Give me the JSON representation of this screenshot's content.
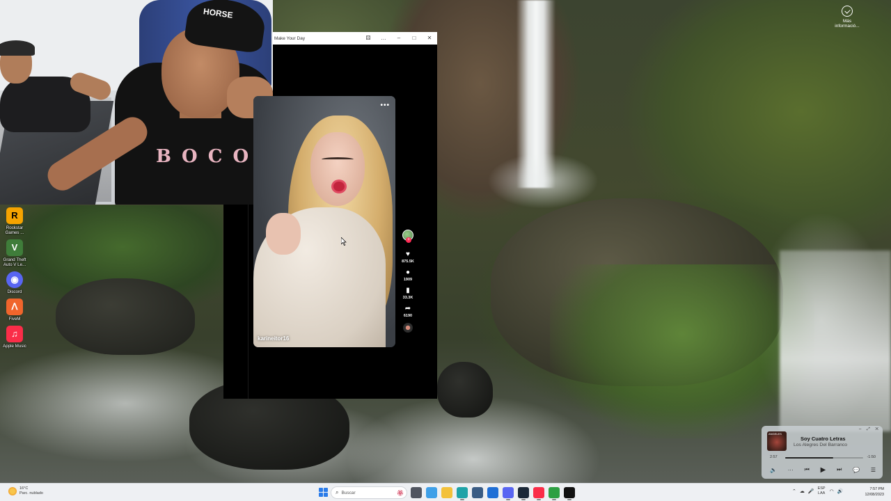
{
  "desktop": {
    "info_widget_label": "Más informació...",
    "icons": [
      {
        "label": "Rockstar Games ...",
        "glyph": "R",
        "color": "#f5a300"
      },
      {
        "label": "Grand Theft Auto V Le...",
        "glyph": "V",
        "color": "#3f7d3a"
      },
      {
        "label": "Discord",
        "glyph": "◉",
        "color": "#5865f2"
      },
      {
        "label": "FiveM",
        "glyph": "ᐱ",
        "color": "#f0652c"
      },
      {
        "label": "Apple Music",
        "glyph": "♫",
        "color": "#fa2d48"
      }
    ]
  },
  "webcam": {
    "cap_logo": "HORSE",
    "shirt_text": "B O C O"
  },
  "window": {
    "title": "Make Your Day",
    "buttons": {
      "game": "⚄",
      "more": "…",
      "minimize": "–",
      "maximize": "□",
      "close": "✕"
    }
  },
  "video": {
    "more_label": "•••",
    "username": "karineitor16",
    "actions": [
      {
        "name": "like",
        "icon": "♥",
        "count": "875.5K"
      },
      {
        "name": "comment",
        "icon": "●",
        "count": "1909"
      },
      {
        "name": "bookmark",
        "icon": "▮",
        "count": "33.3K"
      },
      {
        "name": "share",
        "icon": "➦",
        "count": "6190"
      }
    ]
  },
  "mini_player": {
    "controls_top": "–  ⤢  ✕",
    "art_text": "ANGELES",
    "title": "Soy Cuatro Letras",
    "artist": "Los Alegres Del Barranco",
    "elapsed": "2:57",
    "remaining": "-1:50",
    "progress": 0.62,
    "buttons": {
      "volume": "🔈",
      "options": "···",
      "previous": "⏮",
      "play": "▶",
      "next": "⏭",
      "lyrics": "💬",
      "queue": "☰"
    }
  },
  "taskbar": {
    "weather_temp": "16°C",
    "weather_desc": "Parc. nublado",
    "search_placeholder": "Buscar",
    "search_deco": "🏵",
    "apps": [
      {
        "name": "task-view",
        "color": "#505560",
        "active": false
      },
      {
        "name": "copilot",
        "color": "#3fa0e8",
        "active": false
      },
      {
        "name": "file-explorer",
        "color": "#f3c13a",
        "active": false
      },
      {
        "name": "edge",
        "color": "#1fa3a8",
        "active": true
      },
      {
        "name": "calculator",
        "color": "#3a5c84",
        "active": false
      },
      {
        "name": "outlook",
        "color": "#1f6fd6",
        "active": false
      },
      {
        "name": "discord",
        "color": "#5865f2",
        "active": true
      },
      {
        "name": "steam",
        "color": "#1b2838",
        "active": true
      },
      {
        "name": "apple-music",
        "color": "#fa2d48",
        "active": true
      },
      {
        "name": "xbox",
        "color": "#2ea043",
        "active": true
      },
      {
        "name": "tiktok",
        "color": "#111111",
        "active": true
      }
    ],
    "tray": {
      "chevron": "⌃",
      "cloud": "☁",
      "mic": "🎤",
      "lang_top": "ESP",
      "lang_bottom": "LAA",
      "wifi": "◠",
      "volume": "🔊"
    },
    "time": "7:57 PM",
    "date": "12/08/2023"
  }
}
